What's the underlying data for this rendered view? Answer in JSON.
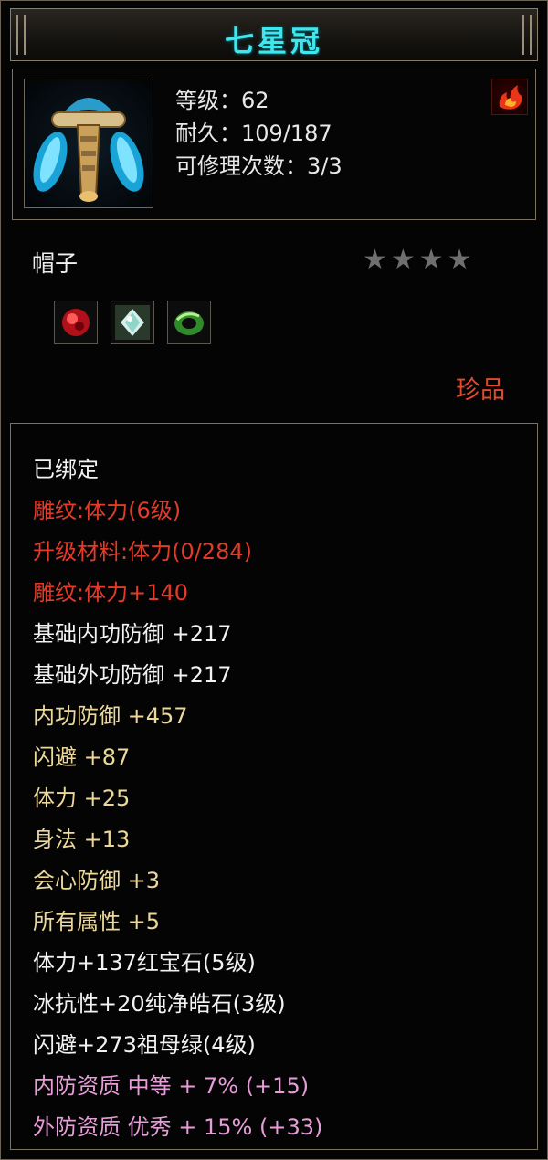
{
  "title": "七星冠",
  "level": "等级：62",
  "durability": "耐久：109/187",
  "repairs": "可修理次数：3/3",
  "item_type": "帽子",
  "stars": "★★★★",
  "star_rating": {
    "filled": 0,
    "total": 4
  },
  "grade": "珍品",
  "sockets": [
    {
      "icon": "ruby-gem-icon"
    },
    {
      "icon": "diamond-gem-icon"
    },
    {
      "icon": "emerald-gem-icon"
    }
  ],
  "colors": {
    "title": "#3fe6ee",
    "red": "#e23b2a",
    "gold": "#ecd89a",
    "pink": "#e79dd8",
    "white": "#f2f2f2"
  },
  "attributes": [
    {
      "text": "已绑定",
      "color": "white"
    },
    {
      "text": "雕纹:体力(6级)",
      "color": "red"
    },
    {
      "text": "升级材料:体力(0/284)",
      "color": "red"
    },
    {
      "text": "雕纹:体力+140",
      "color": "red"
    },
    {
      "text": "基础内功防御 +217",
      "color": "white"
    },
    {
      "text": "基础外功防御 +217",
      "color": "white"
    },
    {
      "text": "内功防御 +457",
      "color": "gold"
    },
    {
      "text": "闪避 +87",
      "color": "gold"
    },
    {
      "text": "体力 +25",
      "color": "gold"
    },
    {
      "text": "身法 +13",
      "color": "gold"
    },
    {
      "text": "会心防御 +3",
      "color": "gold"
    },
    {
      "text": "所有属性 +5",
      "color": "gold"
    },
    {
      "text": "体力+137红宝石(5级)",
      "color": "white"
    },
    {
      "text": "冰抗性+20纯净皓石(3级)",
      "color": "white"
    },
    {
      "text": "闪避+273祖母绿(4级)",
      "color": "white"
    },
    {
      "text": "内防资质 中等 + 7% (+15)",
      "color": "pink"
    },
    {
      "text": "外防资质 优秀 + 15% (+33)",
      "color": "pink"
    }
  ]
}
